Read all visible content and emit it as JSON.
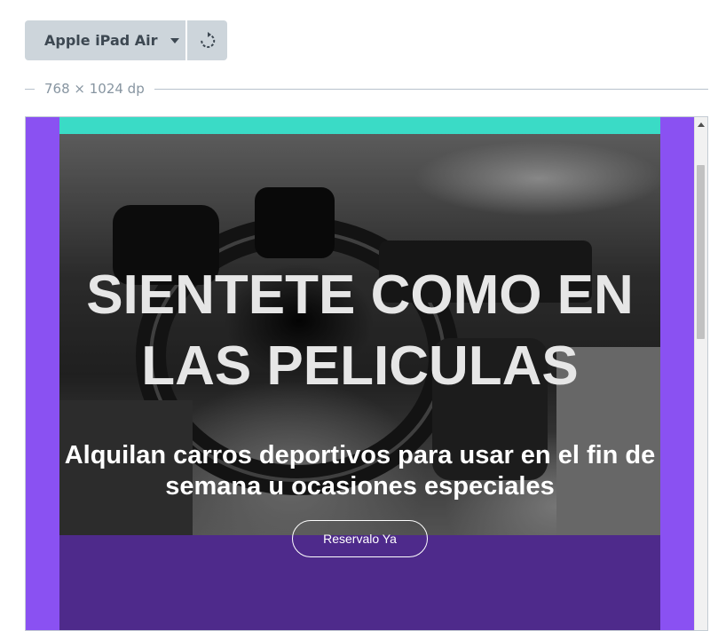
{
  "toolbar": {
    "device_label": "Apple iPad Air",
    "dimensions": "768 × 1024 dp"
  },
  "preview": {
    "hero_title": "SIENTETE COMO EN LAS PELICULAS",
    "hero_subtitle": "Alquilan carros deportivos para usar en el fin de semana u ocasiones especiales",
    "cta_label": "Reservalo Ya"
  },
  "colors": {
    "frame_background": "#8a51f2",
    "top_stripe": "#3adbc6",
    "lower_section": "#4e2a8b",
    "toolbar_button": "#cdd5db"
  },
  "icons": {
    "device_dropdown": "chevron-down-icon",
    "rotate": "rotate-icon",
    "scroll_up": "arrow-up-icon"
  }
}
